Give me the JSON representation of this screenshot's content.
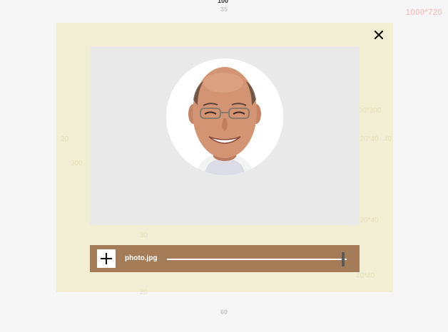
{
  "spec": {
    "top_label": "100",
    "top_sub": "35",
    "canvas_size": "1000*720",
    "bottom_label": "60",
    "left_label": "20",
    "mid_label": "30",
    "dim_a": "100*300",
    "dim_b": "120*40",
    "dim_c": "40",
    "dim_d": "300",
    "dim_e": "120*40",
    "dim_f": "40*40",
    "dim_g": "20"
  },
  "modal": {
    "close_label": "✕"
  },
  "uploader": {
    "filename": "photo.jpg",
    "zoom": 0.98
  },
  "colors": {
    "modal_bg": "#f1eed4",
    "preview_bg": "#e9e9e9",
    "toolbar_bg": "#a47d58"
  }
}
